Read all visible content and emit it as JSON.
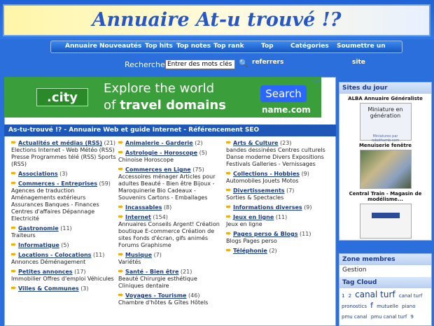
{
  "site_title": "Annuaire At-u trouvé !?",
  "nav": {
    "annuaire": "Annuaire",
    "nouveautes": "Nouveautés",
    "top_hits": "Top hits",
    "top_notes": "Top notes",
    "top_rank": "Top rank",
    "top_rank2": "Top",
    "categories": "Catégories",
    "soumettre": "Soumettre un",
    "site": "site"
  },
  "search": {
    "label": "Recherche",
    "placeholder": "Entrer des mots clés",
    "value": "Entrer des mots clés",
    "referrers": "referrers"
  },
  "ad": {
    "city": ".city",
    "line1": "Explore the world",
    "line2a": "of ",
    "line2b": "travel domains",
    "search_btn": "Search",
    "brand": "name.com",
    "close": "▷✕"
  },
  "main_heading": "As-tu-trouvé !? - Annuaire Web et guide Internet - Référencement SEO",
  "columns": [
    [
      {
        "title": "Actualités et médias (RSS)",
        "count": "(21)",
        "sub": "Elections  Internet - Web  Météo (RSS)  Presse  Programmes télé (RSS)  Sports (RSS)"
      },
      {
        "title": "Associations",
        "count": "(3)",
        "sub": ""
      },
      {
        "title": "Commerces - Entreprises",
        "count": "(59)",
        "sub": "Agences de traduction  Aménagements extérieurs  Assurances  Banques - Finances  Centres d'affaires  Dépannage  Electricité"
      },
      {
        "title": "Gastronomie",
        "count": "(11)",
        "sub": "Traiteurs"
      },
      {
        "title": "Informatique",
        "count": "(5)",
        "sub": ""
      },
      {
        "title": "Locations - Colocations",
        "count": "(11)",
        "sub": "Annonces  Déménagement"
      },
      {
        "title": "Petites annonces",
        "count": "(17)",
        "sub": "Immobilier  Offres d'emploi  Véhicules"
      },
      {
        "title": "Villes & Communes",
        "count": "(3)",
        "sub": ""
      }
    ],
    [
      {
        "title": "Animalerie - Garderie",
        "count": "(2)",
        "sub": ""
      },
      {
        "title": "Astrologie - Horoscope",
        "count": "(5)",
        "sub": "Chinoise  Horoscope"
      },
      {
        "title": "Commerces en Ligne",
        "count": "(75)",
        "sub": "Accessoires ménager  Articles pour adultes  Beauté - Bien être  Bijoux - Maroquinerie  Bio  Cadeaux - Souvenirs  Cartons - Emballages"
      },
      {
        "title": "Incassables",
        "count": "(8)",
        "sub": ""
      },
      {
        "title": "Internet",
        "count": "(154)",
        "sub": "Annuaires  Conseils Argent!  Création boutique E-commerce  Création de sites  Fonds d'écran, gifs animés  Forums  Graphisme"
      },
      {
        "title": "Musique",
        "count": "(7)",
        "sub": "Variétés"
      },
      {
        "title": "Santé - Bien être",
        "count": "(21)",
        "sub": "Beauté  Chirurgie esthétique  Cliniques dentaire"
      },
      {
        "title": "Voyages - Tourisme",
        "count": "(46)",
        "sub": "Chambre d'hôtes & Gîtes  Hôtels"
      }
    ],
    [
      {
        "title": "Arts & Culture",
        "count": "(23)",
        "sub": "bandes dessinées  Centres culturels  Danse moderne  Divers  Expositions  Festivals  Galleries - Vernissages"
      },
      {
        "title": "Collections - Hobbies",
        "count": "(9)",
        "sub": "Automobiles  Jouets  Motos"
      },
      {
        "title": "Divertissements",
        "count": "(7)",
        "sub": "Sorties & Spectacles"
      },
      {
        "title": "Informations diverses",
        "count": "(9)",
        "sub": ""
      },
      {
        "title": "Jeux en ligne",
        "count": "(11)",
        "sub": "Jeux en ligne"
      },
      {
        "title": "Pages perso & Blogs",
        "count": "(11)",
        "sub": "Blogs  Pages perso"
      },
      {
        "title": "Téléphonie",
        "count": "(2)",
        "sub": ""
      }
    ]
  ],
  "sidebar": {
    "sites_du_jour": "Sites du jour",
    "site1_caption": "ALBA Annuaire Généraliste",
    "site1_thumb_text": "Miniature en génération",
    "site1_thumb_sub": "Miniatures par robothumb.com",
    "site2_caption": "Menuiserie fenêtre",
    "site3_caption": "Central Train - Magasin de modélisme...",
    "zone_membres": "Zone membres",
    "gestion": "Gestion",
    "tag_cloud": "Tag Cloud",
    "tags": [
      "1",
      "2",
      "canal turf",
      "canal turf",
      "pronostics",
      "f",
      "mutuelle",
      "piano",
      "pmu canal",
      "pmu canal turf",
      "9"
    ]
  }
}
